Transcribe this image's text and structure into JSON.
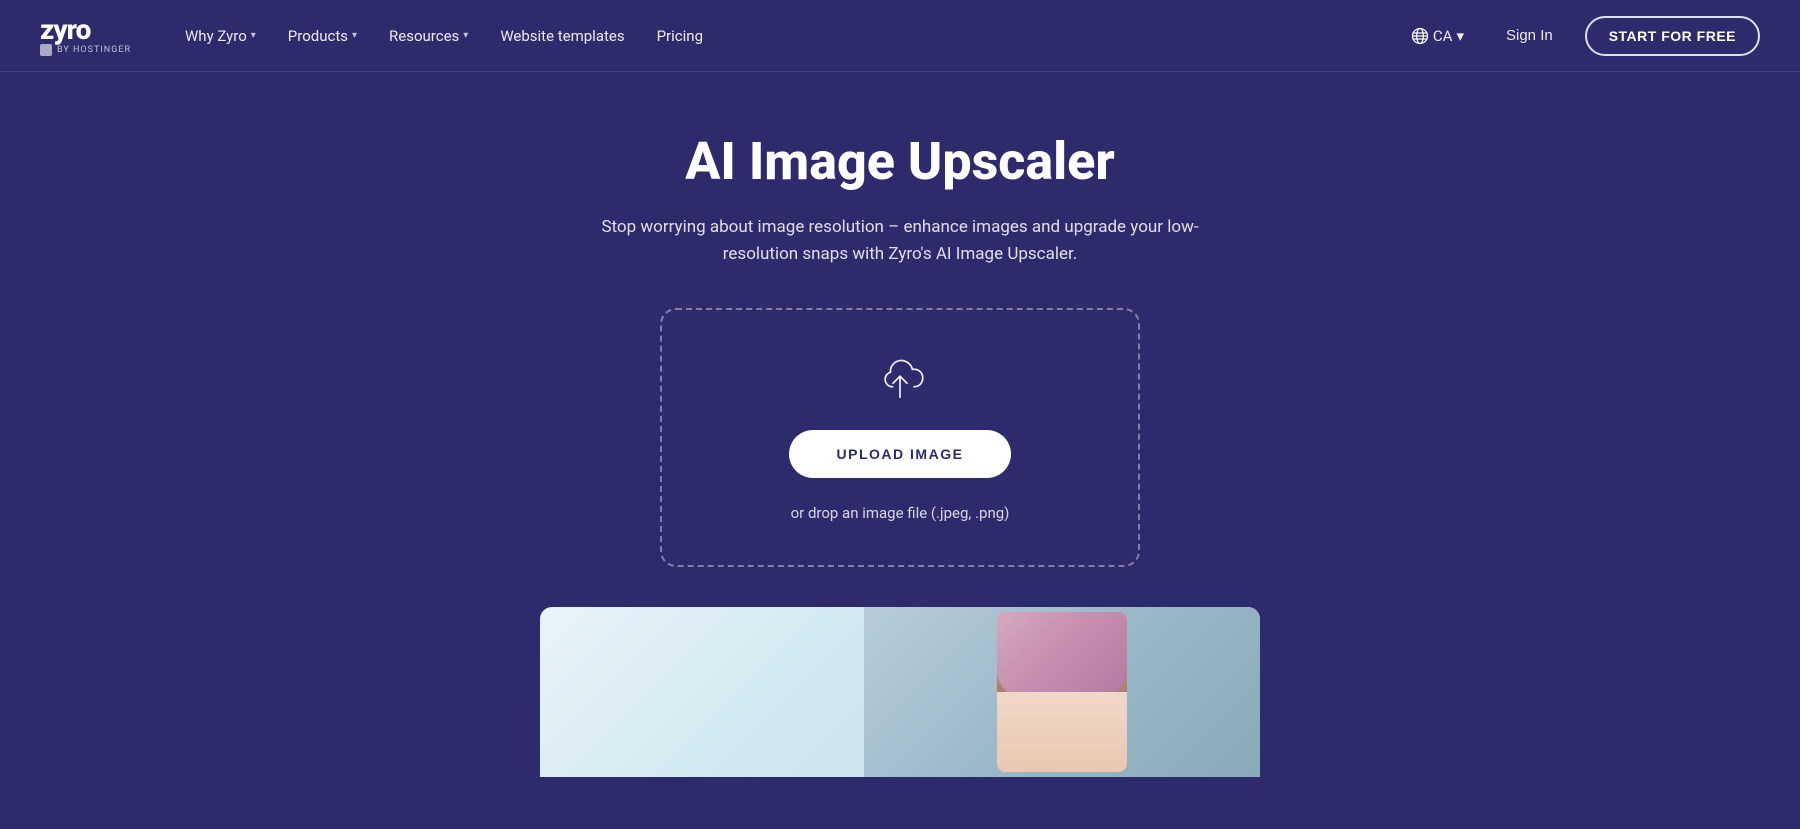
{
  "brand": {
    "logo_name": "zyro",
    "logo_sub": "BY HOSTINGER"
  },
  "navbar": {
    "items": [
      {
        "label": "Why Zyro",
        "has_dropdown": true,
        "id": "why-zyro"
      },
      {
        "label": "Products",
        "has_dropdown": true,
        "id": "products"
      },
      {
        "label": "Resources",
        "has_dropdown": true,
        "id": "resources"
      },
      {
        "label": "Website templates",
        "has_dropdown": false,
        "id": "website-templates"
      },
      {
        "label": "Pricing",
        "has_dropdown": false,
        "id": "pricing"
      }
    ],
    "locale": {
      "icon": "globe",
      "label": "CA",
      "has_dropdown": true
    },
    "sign_in": "Sign In",
    "cta": "START FOR FREE"
  },
  "hero": {
    "title": "AI Image Upscaler",
    "subtitle": "Stop worrying about image resolution – enhance images and upgrade your low-resolution snaps with Zyro's AI Image Upscaler."
  },
  "upload_card": {
    "upload_icon": "cloud-upload",
    "upload_button_label": "UPLOAD IMAGE",
    "hint": "or drop an image file (.jpeg, .png)"
  },
  "colors": {
    "background": "#2d2b6b",
    "card_border": "rgba(255,255,255,0.4)",
    "btn_bg": "#ffffff",
    "btn_text": "#2d2b6b"
  }
}
